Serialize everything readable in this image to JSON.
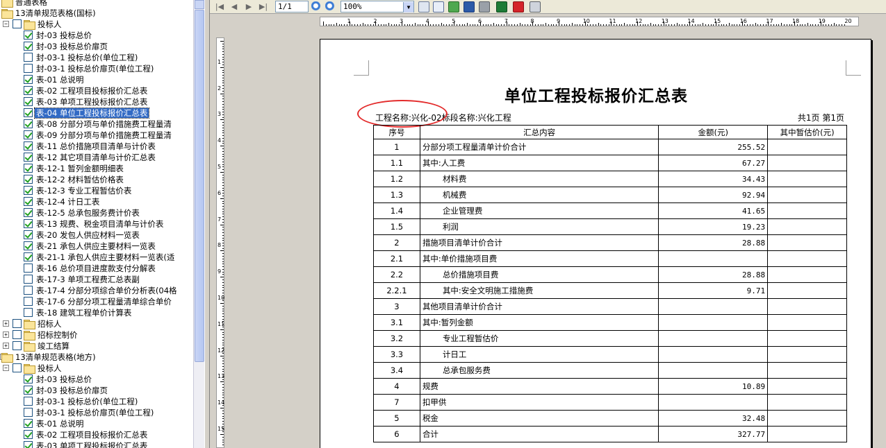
{
  "tree": [
    {
      "indent": 0,
      "expander": "",
      "checked": null,
      "folder": true,
      "label": "普通表格"
    },
    {
      "indent": 0,
      "expander": "",
      "checked": null,
      "folder": true,
      "label": "13清单规范表格(国标)"
    },
    {
      "indent": 1,
      "expander": "−",
      "checked": false,
      "folder": true,
      "label": "投标人"
    },
    {
      "indent": 2,
      "expander": "",
      "checked": true,
      "folder": false,
      "label": "封-03 投标总价"
    },
    {
      "indent": 2,
      "expander": "",
      "checked": true,
      "folder": false,
      "label": "封-03 投标总价扉页"
    },
    {
      "indent": 2,
      "expander": "",
      "checked": false,
      "folder": false,
      "label": "封-03-1 投标总价(单位工程)"
    },
    {
      "indent": 2,
      "expander": "",
      "checked": false,
      "folder": false,
      "label": "封-03-1 投标总价扉页(单位工程)"
    },
    {
      "indent": 2,
      "expander": "",
      "checked": true,
      "folder": false,
      "label": "表-01 总说明"
    },
    {
      "indent": 2,
      "expander": "",
      "checked": true,
      "folder": false,
      "label": "表-02 工程项目投标报价汇总表"
    },
    {
      "indent": 2,
      "expander": "",
      "checked": true,
      "folder": false,
      "label": "表-03 单项工程投标报价汇总表"
    },
    {
      "indent": 2,
      "expander": "",
      "checked": true,
      "folder": false,
      "label": "表-04 单位工程投标报价汇总表",
      "selected": true
    },
    {
      "indent": 2,
      "expander": "",
      "checked": true,
      "folder": false,
      "label": "表-08 分部分项与单价措施费工程量清"
    },
    {
      "indent": 2,
      "expander": "",
      "checked": true,
      "folder": false,
      "label": "表-09 分部分项与单价措施费工程量清"
    },
    {
      "indent": 2,
      "expander": "",
      "checked": true,
      "folder": false,
      "label": "表-11 总价措施项目清单与计价表"
    },
    {
      "indent": 2,
      "expander": "",
      "checked": true,
      "folder": false,
      "label": "表-12 其它项目清单与计价汇总表"
    },
    {
      "indent": 2,
      "expander": "",
      "checked": true,
      "folder": false,
      "label": "表-12-1 暂列金额明细表"
    },
    {
      "indent": 2,
      "expander": "",
      "checked": true,
      "folder": false,
      "label": "表-12-2 材料暂估价格表"
    },
    {
      "indent": 2,
      "expander": "",
      "checked": true,
      "folder": false,
      "label": "表-12-3 专业工程暂估价表"
    },
    {
      "indent": 2,
      "expander": "",
      "checked": true,
      "folder": false,
      "label": "表-12-4 计日工表"
    },
    {
      "indent": 2,
      "expander": "",
      "checked": true,
      "folder": false,
      "label": "表-12-5 总承包服务费计价表"
    },
    {
      "indent": 2,
      "expander": "",
      "checked": true,
      "folder": false,
      "label": "表-13 规费、税金项目清单与计价表"
    },
    {
      "indent": 2,
      "expander": "",
      "checked": true,
      "folder": false,
      "label": "表-20 发包人供应材料一览表"
    },
    {
      "indent": 2,
      "expander": "",
      "checked": true,
      "folder": false,
      "label": "表-21 承包人供应主要材料一览表"
    },
    {
      "indent": 2,
      "expander": "",
      "checked": true,
      "folder": false,
      "label": "表-21-1 承包人供应主要材料一览表(适"
    },
    {
      "indent": 2,
      "expander": "",
      "checked": false,
      "folder": false,
      "label": "表-16 总价项目进度款支付分解表"
    },
    {
      "indent": 2,
      "expander": "",
      "checked": false,
      "folder": false,
      "label": "表-17-3 单项工程费汇总表副"
    },
    {
      "indent": 2,
      "expander": "",
      "checked": false,
      "folder": false,
      "label": "表-17-4 分部分项综合单价分析表(04格"
    },
    {
      "indent": 2,
      "expander": "",
      "checked": false,
      "folder": false,
      "label": "表-17-6 分部分项工程量清单综合单价"
    },
    {
      "indent": 2,
      "expander": "",
      "checked": false,
      "folder": false,
      "label": "表-18 建筑工程单价计算表"
    },
    {
      "indent": 1,
      "expander": "+",
      "checked": false,
      "folder": true,
      "label": "招标人"
    },
    {
      "indent": 1,
      "expander": "+",
      "checked": false,
      "folder": true,
      "label": "招标控制价"
    },
    {
      "indent": 1,
      "expander": "+",
      "checked": false,
      "folder": true,
      "label": "竣工结算"
    },
    {
      "indent": 0,
      "expander": "−",
      "checked": null,
      "folder": true,
      "label": "13清单规范表格(地方)"
    },
    {
      "indent": 1,
      "expander": "−",
      "checked": false,
      "folder": true,
      "label": "投标人"
    },
    {
      "indent": 2,
      "expander": "",
      "checked": true,
      "folder": false,
      "label": "封-03 投标总价"
    },
    {
      "indent": 2,
      "expander": "",
      "checked": true,
      "folder": false,
      "label": "封-03 投标总价扉页"
    },
    {
      "indent": 2,
      "expander": "",
      "checked": false,
      "folder": false,
      "label": "封-03-1 投标总价(单位工程)"
    },
    {
      "indent": 2,
      "expander": "",
      "checked": false,
      "folder": false,
      "label": "封-03-1 投标总价扉页(单位工程)"
    },
    {
      "indent": 2,
      "expander": "",
      "checked": true,
      "folder": false,
      "label": "表-01 总说明"
    },
    {
      "indent": 2,
      "expander": "",
      "checked": true,
      "folder": false,
      "label": "表-02 工程项目投标报价汇总表"
    },
    {
      "indent": 2,
      "expander": "",
      "checked": true,
      "folder": false,
      "label": "表-03 单项工程投标报价汇总表"
    }
  ],
  "toolbar": {
    "page_value": "1/1",
    "zoom_value": "100%"
  },
  "ruler": {
    "h_numbers": [
      "1",
      "2",
      "3",
      "4",
      "5",
      "6",
      "7",
      "8",
      "9",
      "10",
      "11",
      "12",
      "13",
      "14",
      "15",
      "16",
      "17",
      "18",
      "19",
      "20"
    ],
    "v_numbers": [
      "1",
      "2",
      "3",
      "4",
      "5",
      "6",
      "7",
      "8",
      "9",
      "10",
      "11",
      "12",
      "13",
      "14",
      "15"
    ]
  },
  "report": {
    "title": "单位工程投标报价汇总表",
    "project_name": "工程名称:兴化-02",
    "section_name": "标段名称:兴化工程",
    "page_info": "共1页 第1页",
    "headers": [
      "序号",
      "汇总内容",
      "金额(元)",
      "其中暂估价(元)"
    ],
    "rows": [
      {
        "idx": "1",
        "name": "分部分项工程量清单计价合计",
        "amount": "255.52",
        "indent": 0
      },
      {
        "idx": "1.1",
        "name": "其中:人工费",
        "amount": "67.27",
        "indent": 0
      },
      {
        "idx": "1.2",
        "name": "材料费",
        "amount": "34.43",
        "indent": 1
      },
      {
        "idx": "1.3",
        "name": "机械费",
        "amount": "92.94",
        "indent": 1
      },
      {
        "idx": "1.4",
        "name": "企业管理费",
        "amount": "41.65",
        "indent": 1
      },
      {
        "idx": "1.5",
        "name": "利润",
        "amount": "19.23",
        "indent": 1
      },
      {
        "idx": "2",
        "name": "措施项目清单计价合计",
        "amount": "28.88",
        "indent": 0
      },
      {
        "idx": "2.1",
        "name": "其中:单价措施项目费",
        "amount": "",
        "indent": 0
      },
      {
        "idx": "2.2",
        "name": "总价措施项目费",
        "amount": "28.88",
        "indent": 1
      },
      {
        "idx": "2.2.1",
        "name": "其中:安全文明施工措施费",
        "amount": "9.71",
        "indent": 1
      },
      {
        "idx": "3",
        "name": "其他项目清单计价合计",
        "amount": "",
        "indent": 0
      },
      {
        "idx": "3.1",
        "name": "其中:暂列金额",
        "amount": "",
        "indent": 0
      },
      {
        "idx": "3.2",
        "name": "专业工程暂估价",
        "amount": "",
        "indent": 1
      },
      {
        "idx": "3.3",
        "name": "计日工",
        "amount": "",
        "indent": 1
      },
      {
        "idx": "3.4",
        "name": "总承包服务费",
        "amount": "",
        "indent": 1
      },
      {
        "idx": "4",
        "name": "规费",
        "amount": "10.89",
        "indent": 0
      },
      {
        "idx": "7",
        "name": "扣甲供",
        "amount": "",
        "indent": 0
      },
      {
        "idx": "5",
        "name": "税金",
        "amount": "32.48",
        "indent": 0
      },
      {
        "idx": "6",
        "name": "合计",
        "amount": "327.77",
        "indent": 0
      }
    ]
  }
}
